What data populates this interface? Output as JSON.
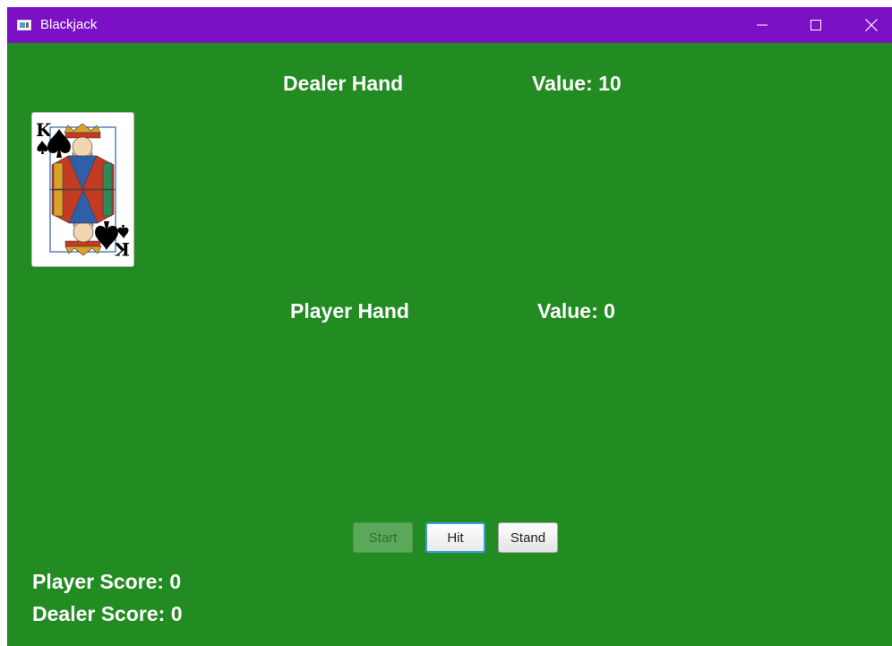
{
  "window": {
    "title": "Blackjack",
    "icons": {
      "app": "app-window-icon",
      "minimize": "minimize-icon",
      "maximize": "maximize-icon",
      "close": "close-icon"
    }
  },
  "dealer": {
    "hand_title": "Dealer Hand",
    "value_label": "Value: 10",
    "cards": [
      {
        "rank": "K",
        "suit": "spades"
      }
    ]
  },
  "player": {
    "hand_title": "Player Hand",
    "value_label": "Value: 0",
    "cards": []
  },
  "controls": {
    "start_label": "Start",
    "hit_label": "Hit",
    "stand_label": "Stand"
  },
  "scores": {
    "player_label": "Player Score: 0",
    "dealer_label": "Dealer Score: 0"
  },
  "colors": {
    "titlebar": "#7B10C4",
    "table": "#228B22",
    "text": "#FFFFFF"
  }
}
